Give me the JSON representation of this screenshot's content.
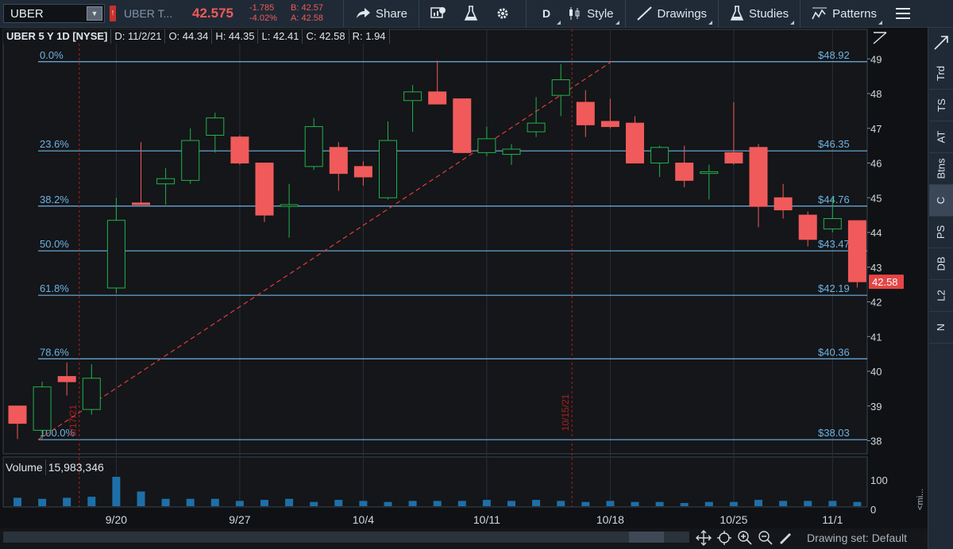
{
  "toolbar": {
    "symbol": "UBER",
    "description": "UBER T...",
    "last_price": "42.575",
    "change": "-1.785",
    "change_pct": "-4.02%",
    "bid": "B: 42.57",
    "ask": "A: 42.58",
    "share_label": "Share",
    "period": "D",
    "style_label": "Style",
    "drawings_label": "Drawings",
    "studies_label": "Studies",
    "patterns_label": "Patterns"
  },
  "info_bar": {
    "title": "UBER 5 Y 1D [NYSE]",
    "date": "D: 11/2/21",
    "open": "O: 44.34",
    "high": "H: 44.35",
    "low": "L: 42.41",
    "close": "C: 42.58",
    "range": "R: 1.94"
  },
  "volume": {
    "label": "Volume",
    "value": "15,983,346",
    "axis_labels": [
      "100",
      "0"
    ]
  },
  "fib_levels": [
    {
      "pct": "0.0%",
      "price": "$48.92",
      "value": 48.92
    },
    {
      "pct": "23.6%",
      "price": "$46.35",
      "value": 46.35
    },
    {
      "pct": "38.2%",
      "price": "$44.76",
      "value": 44.76
    },
    {
      "pct": "50.0%",
      "price": "$43.47",
      "value": 43.47
    },
    {
      "pct": "61.8%",
      "price": "$42.19",
      "value": 42.19
    },
    {
      "pct": "78.6%",
      "price": "$40.36",
      "value": 40.36
    },
    {
      "pct": "100.0%",
      "price": "$38.03",
      "value": 38.03
    }
  ],
  "price_axis": [
    "49",
    "48",
    "47",
    "46",
    "45",
    "44",
    "43",
    "42",
    "41",
    "40",
    "39",
    "38"
  ],
  "current_price_tag": "42.58",
  "date_axis": [
    "9/20",
    "9/27",
    "10/4",
    "10/11",
    "10/18",
    "10/25",
    "11/1"
  ],
  "vertical_markers": [
    "9/17/21",
    "10/15/21"
  ],
  "colors": {
    "up": "#22b14c",
    "down": "#f05a5a",
    "fib": "#6fb2e3",
    "volume": "#1e6fa8"
  },
  "side_tabs": [
    "Trd",
    "TS",
    "AT",
    "Btns",
    "C",
    "PS",
    "DB",
    "L2",
    "N"
  ],
  "active_side_tab": "C",
  "bottom": {
    "drawing_set": "Drawing set: Default",
    "mini_label": "<mi..."
  },
  "chart_data": {
    "type": "candlestick",
    "ylim": [
      37.6,
      49.5
    ],
    "candles": [
      {
        "o": 39.0,
        "h": 39.0,
        "l": 38.05,
        "c": 38.5
      },
      {
        "o": 38.3,
        "h": 39.7,
        "l": 38.05,
        "c": 39.55
      },
      {
        "o": 39.85,
        "h": 40.25,
        "l": 39.3,
        "c": 39.7
      },
      {
        "o": 38.9,
        "h": 40.2,
        "l": 38.75,
        "c": 39.8
      },
      {
        "o": 42.4,
        "h": 45.0,
        "l": 42.25,
        "c": 44.35
      },
      {
        "o": 44.85,
        "h": 46.6,
        "l": 44.8,
        "c": 44.8
      },
      {
        "o": 45.4,
        "h": 45.85,
        "l": 44.8,
        "c": 45.55
      },
      {
        "o": 45.5,
        "h": 47.0,
        "l": 45.4,
        "c": 46.65
      },
      {
        "o": 46.8,
        "h": 47.45,
        "l": 46.3,
        "c": 47.3
      },
      {
        "o": 46.75,
        "h": 46.8,
        "l": 45.95,
        "c": 46.0
      },
      {
        "o": 46.0,
        "h": 46.0,
        "l": 44.3,
        "c": 44.5
      },
      {
        "o": 44.75,
        "h": 45.4,
        "l": 43.85,
        "c": 44.8
      },
      {
        "o": 45.9,
        "h": 47.3,
        "l": 45.8,
        "c": 47.05
      },
      {
        "o": 46.45,
        "h": 46.6,
        "l": 45.2,
        "c": 45.7
      },
      {
        "o": 45.9,
        "h": 46.05,
        "l": 45.35,
        "c": 45.6
      },
      {
        "o": 45.0,
        "h": 47.2,
        "l": 44.95,
        "c": 46.65
      },
      {
        "o": 47.8,
        "h": 48.25,
        "l": 46.9,
        "c": 48.05
      },
      {
        "o": 48.05,
        "h": 48.95,
        "l": 47.7,
        "c": 47.7
      },
      {
        "o": 47.85,
        "h": 47.85,
        "l": 46.3,
        "c": 46.3
      },
      {
        "o": 46.3,
        "h": 47.05,
        "l": 46.2,
        "c": 46.7
      },
      {
        "o": 46.25,
        "h": 46.55,
        "l": 45.95,
        "c": 46.4
      },
      {
        "o": 46.9,
        "h": 47.9,
        "l": 46.75,
        "c": 47.15
      },
      {
        "o": 47.95,
        "h": 48.85,
        "l": 47.35,
        "c": 48.4
      },
      {
        "o": 47.75,
        "h": 48.1,
        "l": 46.75,
        "c": 47.1
      },
      {
        "o": 47.2,
        "h": 47.85,
        "l": 47.0,
        "c": 47.05
      },
      {
        "o": 47.15,
        "h": 47.35,
        "l": 46.0,
        "c": 46.0
      },
      {
        "o": 46.0,
        "h": 46.5,
        "l": 45.6,
        "c": 46.45
      },
      {
        "o": 46.0,
        "h": 46.5,
        "l": 45.3,
        "c": 45.5
      },
      {
        "o": 45.7,
        "h": 45.95,
        "l": 44.95,
        "c": 45.75
      },
      {
        "o": 46.3,
        "h": 47.75,
        "l": 45.95,
        "c": 46.0
      },
      {
        "o": 46.45,
        "h": 46.55,
        "l": 44.15,
        "c": 44.75
      },
      {
        "o": 45.0,
        "h": 45.4,
        "l": 44.4,
        "c": 44.65
      },
      {
        "o": 44.5,
        "h": 44.6,
        "l": 43.6,
        "c": 43.8
      },
      {
        "o": 44.1,
        "h": 45.0,
        "l": 44.0,
        "c": 44.4
      },
      {
        "o": 44.34,
        "h": 44.35,
        "l": 42.41,
        "c": 42.58
      }
    ],
    "volumes": [
      8,
      7,
      8,
      9,
      28,
      14,
      7,
      7,
      7,
      5,
      6,
      7,
      4,
      6,
      5,
      4,
      5,
      5,
      5,
      6,
      5,
      6,
      5,
      4,
      5,
      4,
      4,
      3,
      4,
      4,
      6,
      5,
      5,
      5,
      4
    ]
  }
}
